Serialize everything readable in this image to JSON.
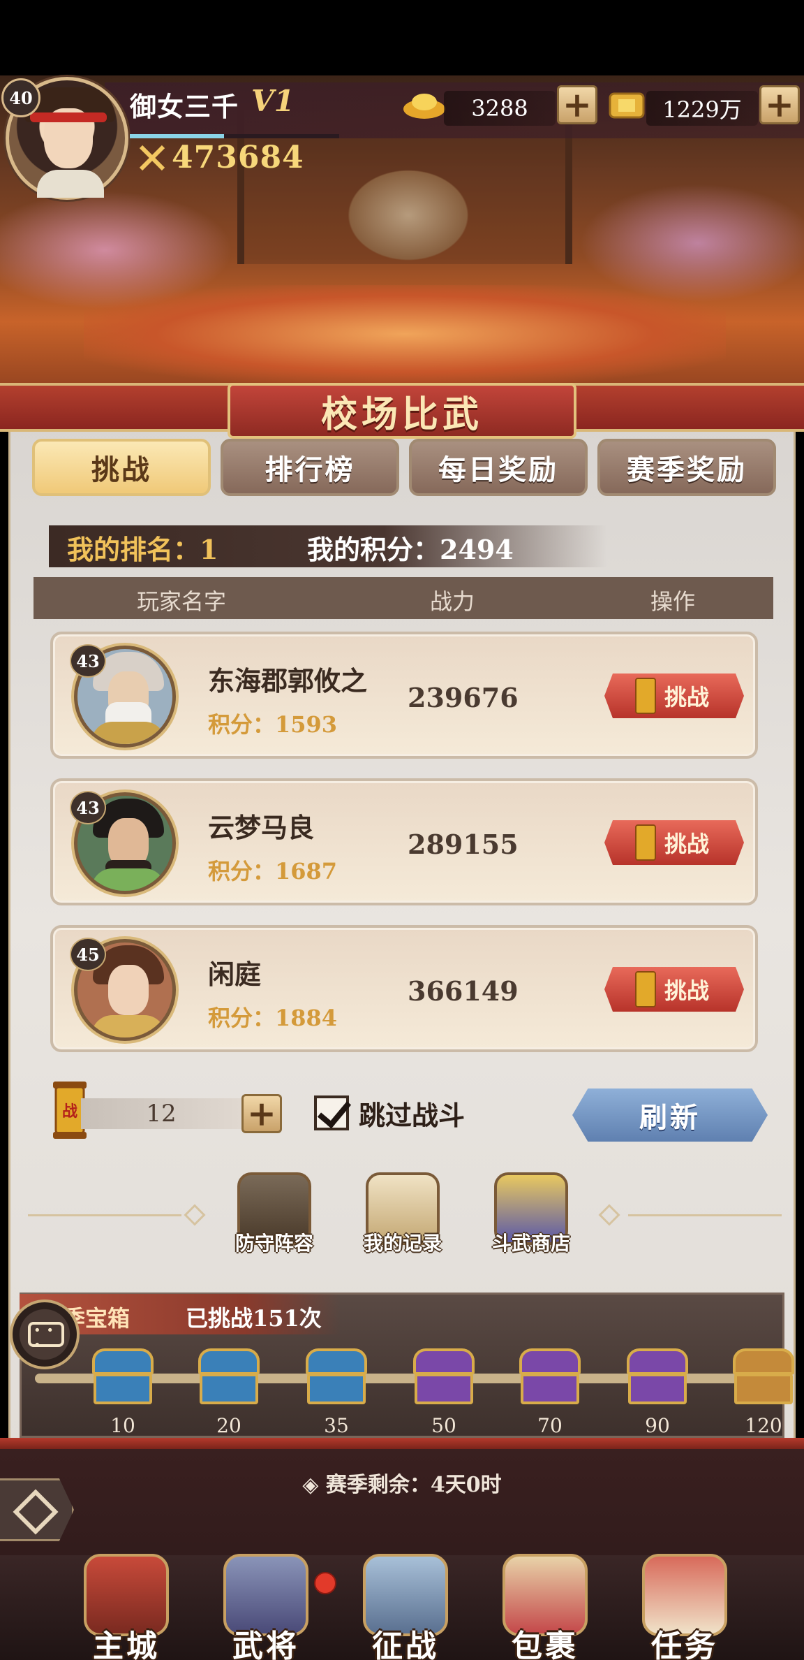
{
  "player": {
    "level": "40",
    "name": "御女三千",
    "vip": "V1",
    "power": "473684",
    "exp_progress": 0.45
  },
  "resources": {
    "gold_ingot": "3288",
    "coins": "1229万"
  },
  "panel": {
    "title": "校场比武",
    "tabs": [
      {
        "label": "挑战",
        "active": true
      },
      {
        "label": "排行榜",
        "active": false
      },
      {
        "label": "每日奖励",
        "active": false
      },
      {
        "label": "赛季奖励",
        "active": false
      }
    ],
    "my_rank": "我的排名：1",
    "my_score": "我的积分：2494",
    "columns": [
      "玩家名字",
      "战力",
      "操作"
    ]
  },
  "opponents": [
    {
      "level": "43",
      "name": "东海郡郭攸之",
      "score": "积分：1593",
      "power": "239676",
      "action": "挑战"
    },
    {
      "level": "43",
      "name": "云梦马良",
      "score": "积分：1687",
      "power": "289155",
      "action": "挑战"
    },
    {
      "level": "45",
      "name": "闲庭",
      "score": "积分：1884",
      "power": "366149",
      "action": "挑战"
    }
  ],
  "controls": {
    "tickets": "12",
    "skip_battle": "跳过战斗",
    "skip_checked": true,
    "refresh": "刷新",
    "token_char": "战"
  },
  "functions": [
    {
      "label": "防守阵容",
      "icon": "shield-formation-icon"
    },
    {
      "label": "我的记录",
      "icon": "scroll-record-icon"
    },
    {
      "label": "斗武商店",
      "icon": "treasure-shop-icon"
    }
  ],
  "season": {
    "title": "季宝箱",
    "challenged": "已挑战151次",
    "chests": [
      {
        "count": "10",
        "color": "blue"
      },
      {
        "count": "20",
        "color": "blue"
      },
      {
        "count": "35",
        "color": "blue"
      },
      {
        "count": "50",
        "color": "purple"
      },
      {
        "count": "70",
        "color": "purple"
      },
      {
        "count": "90",
        "color": "purple"
      },
      {
        "count": "120",
        "color": "gold"
      }
    ],
    "remaining": "◈ 赛季剩余：4天0时"
  },
  "nav": [
    {
      "label": "主城",
      "icon": "city-icon"
    },
    {
      "label": "武将",
      "icon": "general-icon"
    },
    {
      "label": "征战",
      "icon": "crossed-swords-icon"
    },
    {
      "label": "包裹",
      "icon": "bag-icon"
    },
    {
      "label": "任务",
      "icon": "task-icon"
    }
  ],
  "colors": {
    "accent_red": "#b7332a",
    "tab_active": "#f0c978",
    "score_gold": "#d49a3a",
    "refresh_blue": "#5f80b0"
  }
}
